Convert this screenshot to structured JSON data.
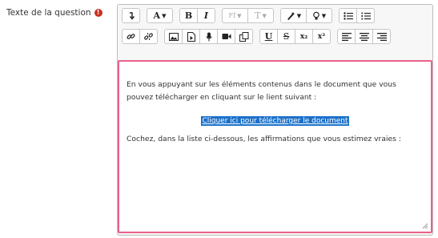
{
  "field": {
    "label": "Texte de la question",
    "required_icon": "!"
  },
  "toolbar": {
    "row1": [
      [
        "collapse-toolbar-icon"
      ],
      [
        "paragraph-style-icon"
      ],
      [
        "bold-icon",
        "italic-icon"
      ],
      [
        "font-family-icon",
        "font-size-icon"
      ],
      [
        "font-color-icon",
        "highlight-icon"
      ],
      [
        "bulleted-list-icon",
        "numbered-list-icon"
      ]
    ],
    "row2": [
      [
        "link-icon",
        "unlink-icon"
      ],
      [
        "image-icon",
        "media-icon",
        "record-audio-icon",
        "record-video-icon",
        "manage-files-icon"
      ],
      [
        "underline-icon",
        "strikethrough-icon",
        "subscript-icon",
        "superscript-icon"
      ],
      [
        "align-left-icon",
        "align-center-icon",
        "align-right-icon"
      ]
    ],
    "glyphs": {
      "paragraph": "A",
      "bold": "B",
      "italic": "I",
      "font_family": "Ff",
      "font_size": "T",
      "underline": "U",
      "strike": "S",
      "subscript": "x₂",
      "superscript": "x²"
    }
  },
  "content": {
    "paragraph1_line1": "En vous appuyant sur les éléments contenus dans le document que vous",
    "paragraph1_line2": "pouvez télécharger en cliquant sur le lient suivant :",
    "link_text": "Cliquer ici pour télécharger le document",
    "paragraph2": "Cochez, dans la liste ci-dessous, les affirmations que vous estimez vraies :"
  },
  "colors": {
    "focus_border": "#e8628a",
    "selection": "#1a71c9",
    "required": "#ca3120"
  }
}
